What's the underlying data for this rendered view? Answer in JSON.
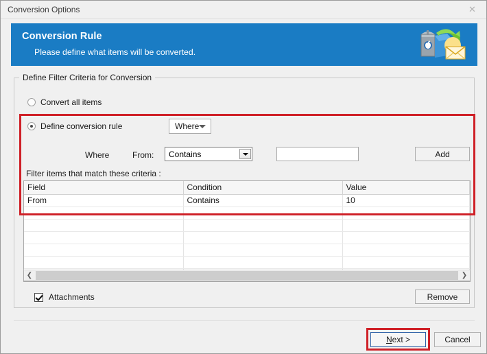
{
  "window": {
    "title": "Conversion Options",
    "close_icon": "close-icon"
  },
  "banner": {
    "title": "Conversion Rule",
    "subtitle": "Please define what items will be converted.",
    "icon": "mailbox-convert-to-mail-icon",
    "color": "#1a7cc4"
  },
  "groupbox": {
    "legend": "Define Filter Criteria for Conversion"
  },
  "options": {
    "convert_all": {
      "label": "Convert all items",
      "selected": false
    },
    "define_rule": {
      "label": "Define conversion rule",
      "selected": true
    },
    "scope_dropdown": {
      "value": "Where",
      "arrow_icon": "chevron-down-icon"
    }
  },
  "criteria_builder": {
    "where_label": "Where",
    "from_label": "From:",
    "condition_dropdown": {
      "value": "Contains",
      "arrow_icon": "chevron-down-icon"
    },
    "value_input": {
      "value": "",
      "placeholder": ""
    },
    "add_button": "Add"
  },
  "criteria_table": {
    "caption": "Filter items that match these criteria :",
    "columns": [
      "Field",
      "Condition",
      "Value"
    ],
    "rows": [
      [
        "From",
        "Contains",
        "10"
      ]
    ],
    "empty_row_count": 7,
    "scrollbar": {
      "left_arrow_icon": "chevron-left-icon",
      "right_arrow_icon": "chevron-right-icon"
    }
  },
  "bottom": {
    "attachments": {
      "label": "Attachments",
      "checked": true
    },
    "remove_button": "Remove"
  },
  "footer": {
    "next_button_prefix": "N",
    "next_button_rest": "ext >",
    "cancel_button": "Cancel"
  },
  "annotations": {
    "highlight_color": "#cf2027",
    "rule_box": "define-conversion-rule-highlight",
    "next_box": "next-button-highlight"
  }
}
